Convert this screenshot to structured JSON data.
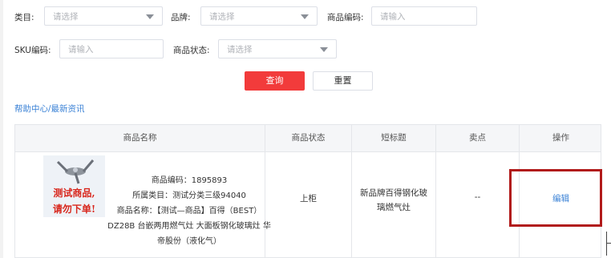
{
  "filters": {
    "category": {
      "label": "类目:",
      "placeholder": "请选择"
    },
    "brand": {
      "label": "品牌:",
      "placeholder": "请选择"
    },
    "product_code": {
      "label": "商品编码:",
      "placeholder": "请输入"
    },
    "sku_code": {
      "label": "SKU编码:",
      "placeholder": "请输入"
    },
    "status": {
      "label": "商品状态:",
      "placeholder": "请选择"
    }
  },
  "actions": {
    "query": "查询",
    "reset": "重置"
  },
  "help_link": "帮助中心/最新资讯",
  "table": {
    "headers": [
      "商品名称",
      "商品状态",
      "短标题",
      "卖点",
      "操作"
    ],
    "rows": [
      {
        "image_text": [
          "测试商品,",
          "请勿下单!"
        ],
        "info": {
          "code": "商品编码：1895893",
          "category": "所属类目：测试分类三级94040",
          "name": "商品名称：【测试—商品】百得（BEST）DZ28B 台嵌两用燃气灶 大面板钢化玻璃灶 华帝股份（液化气）"
        },
        "status": "上柜",
        "short_title": "新品牌百得钢化玻璃燃气灶",
        "selling_point": "--",
        "action": "编辑"
      }
    ]
  },
  "colors": {
    "primary": "#f23b3b",
    "link": "#3b82d6",
    "highlight": "#b11a1a"
  }
}
